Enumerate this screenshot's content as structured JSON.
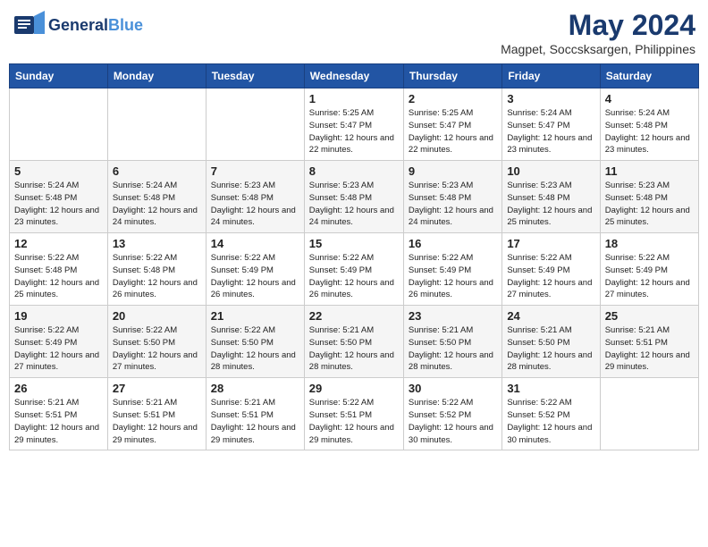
{
  "header": {
    "logo_line1": "General",
    "logo_line2": "Blue",
    "main_title": "May 2024",
    "subtitle": "Magpet, Soccsksargen, Philippines"
  },
  "weekdays": [
    "Sunday",
    "Monday",
    "Tuesday",
    "Wednesday",
    "Thursday",
    "Friday",
    "Saturday"
  ],
  "weeks": [
    [
      {
        "day": "",
        "sunrise": "",
        "sunset": "",
        "daylight": ""
      },
      {
        "day": "",
        "sunrise": "",
        "sunset": "",
        "daylight": ""
      },
      {
        "day": "",
        "sunrise": "",
        "sunset": "",
        "daylight": ""
      },
      {
        "day": "1",
        "sunrise": "Sunrise: 5:25 AM",
        "sunset": "Sunset: 5:47 PM",
        "daylight": "Daylight: 12 hours and 22 minutes."
      },
      {
        "day": "2",
        "sunrise": "Sunrise: 5:25 AM",
        "sunset": "Sunset: 5:47 PM",
        "daylight": "Daylight: 12 hours and 22 minutes."
      },
      {
        "day": "3",
        "sunrise": "Sunrise: 5:24 AM",
        "sunset": "Sunset: 5:47 PM",
        "daylight": "Daylight: 12 hours and 23 minutes."
      },
      {
        "day": "4",
        "sunrise": "Sunrise: 5:24 AM",
        "sunset": "Sunset: 5:48 PM",
        "daylight": "Daylight: 12 hours and 23 minutes."
      }
    ],
    [
      {
        "day": "5",
        "sunrise": "Sunrise: 5:24 AM",
        "sunset": "Sunset: 5:48 PM",
        "daylight": "Daylight: 12 hours and 23 minutes."
      },
      {
        "day": "6",
        "sunrise": "Sunrise: 5:24 AM",
        "sunset": "Sunset: 5:48 PM",
        "daylight": "Daylight: 12 hours and 24 minutes."
      },
      {
        "day": "7",
        "sunrise": "Sunrise: 5:23 AM",
        "sunset": "Sunset: 5:48 PM",
        "daylight": "Daylight: 12 hours and 24 minutes."
      },
      {
        "day": "8",
        "sunrise": "Sunrise: 5:23 AM",
        "sunset": "Sunset: 5:48 PM",
        "daylight": "Daylight: 12 hours and 24 minutes."
      },
      {
        "day": "9",
        "sunrise": "Sunrise: 5:23 AM",
        "sunset": "Sunset: 5:48 PM",
        "daylight": "Daylight: 12 hours and 24 minutes."
      },
      {
        "day": "10",
        "sunrise": "Sunrise: 5:23 AM",
        "sunset": "Sunset: 5:48 PM",
        "daylight": "Daylight: 12 hours and 25 minutes."
      },
      {
        "day": "11",
        "sunrise": "Sunrise: 5:23 AM",
        "sunset": "Sunset: 5:48 PM",
        "daylight": "Daylight: 12 hours and 25 minutes."
      }
    ],
    [
      {
        "day": "12",
        "sunrise": "Sunrise: 5:22 AM",
        "sunset": "Sunset: 5:48 PM",
        "daylight": "Daylight: 12 hours and 25 minutes."
      },
      {
        "day": "13",
        "sunrise": "Sunrise: 5:22 AM",
        "sunset": "Sunset: 5:48 PM",
        "daylight": "Daylight: 12 hours and 26 minutes."
      },
      {
        "day": "14",
        "sunrise": "Sunrise: 5:22 AM",
        "sunset": "Sunset: 5:49 PM",
        "daylight": "Daylight: 12 hours and 26 minutes."
      },
      {
        "day": "15",
        "sunrise": "Sunrise: 5:22 AM",
        "sunset": "Sunset: 5:49 PM",
        "daylight": "Daylight: 12 hours and 26 minutes."
      },
      {
        "day": "16",
        "sunrise": "Sunrise: 5:22 AM",
        "sunset": "Sunset: 5:49 PM",
        "daylight": "Daylight: 12 hours and 26 minutes."
      },
      {
        "day": "17",
        "sunrise": "Sunrise: 5:22 AM",
        "sunset": "Sunset: 5:49 PM",
        "daylight": "Daylight: 12 hours and 27 minutes."
      },
      {
        "day": "18",
        "sunrise": "Sunrise: 5:22 AM",
        "sunset": "Sunset: 5:49 PM",
        "daylight": "Daylight: 12 hours and 27 minutes."
      }
    ],
    [
      {
        "day": "19",
        "sunrise": "Sunrise: 5:22 AM",
        "sunset": "Sunset: 5:49 PM",
        "daylight": "Daylight: 12 hours and 27 minutes."
      },
      {
        "day": "20",
        "sunrise": "Sunrise: 5:22 AM",
        "sunset": "Sunset: 5:50 PM",
        "daylight": "Daylight: 12 hours and 27 minutes."
      },
      {
        "day": "21",
        "sunrise": "Sunrise: 5:22 AM",
        "sunset": "Sunset: 5:50 PM",
        "daylight": "Daylight: 12 hours and 28 minutes."
      },
      {
        "day": "22",
        "sunrise": "Sunrise: 5:21 AM",
        "sunset": "Sunset: 5:50 PM",
        "daylight": "Daylight: 12 hours and 28 minutes."
      },
      {
        "day": "23",
        "sunrise": "Sunrise: 5:21 AM",
        "sunset": "Sunset: 5:50 PM",
        "daylight": "Daylight: 12 hours and 28 minutes."
      },
      {
        "day": "24",
        "sunrise": "Sunrise: 5:21 AM",
        "sunset": "Sunset: 5:50 PM",
        "daylight": "Daylight: 12 hours and 28 minutes."
      },
      {
        "day": "25",
        "sunrise": "Sunrise: 5:21 AM",
        "sunset": "Sunset: 5:51 PM",
        "daylight": "Daylight: 12 hours and 29 minutes."
      }
    ],
    [
      {
        "day": "26",
        "sunrise": "Sunrise: 5:21 AM",
        "sunset": "Sunset: 5:51 PM",
        "daylight": "Daylight: 12 hours and 29 minutes."
      },
      {
        "day": "27",
        "sunrise": "Sunrise: 5:21 AM",
        "sunset": "Sunset: 5:51 PM",
        "daylight": "Daylight: 12 hours and 29 minutes."
      },
      {
        "day": "28",
        "sunrise": "Sunrise: 5:21 AM",
        "sunset": "Sunset: 5:51 PM",
        "daylight": "Daylight: 12 hours and 29 minutes."
      },
      {
        "day": "29",
        "sunrise": "Sunrise: 5:22 AM",
        "sunset": "Sunset: 5:51 PM",
        "daylight": "Daylight: 12 hours and 29 minutes."
      },
      {
        "day": "30",
        "sunrise": "Sunrise: 5:22 AM",
        "sunset": "Sunset: 5:52 PM",
        "daylight": "Daylight: 12 hours and 30 minutes."
      },
      {
        "day": "31",
        "sunrise": "Sunrise: 5:22 AM",
        "sunset": "Sunset: 5:52 PM",
        "daylight": "Daylight: 12 hours and 30 minutes."
      },
      {
        "day": "",
        "sunrise": "",
        "sunset": "",
        "daylight": ""
      }
    ]
  ]
}
